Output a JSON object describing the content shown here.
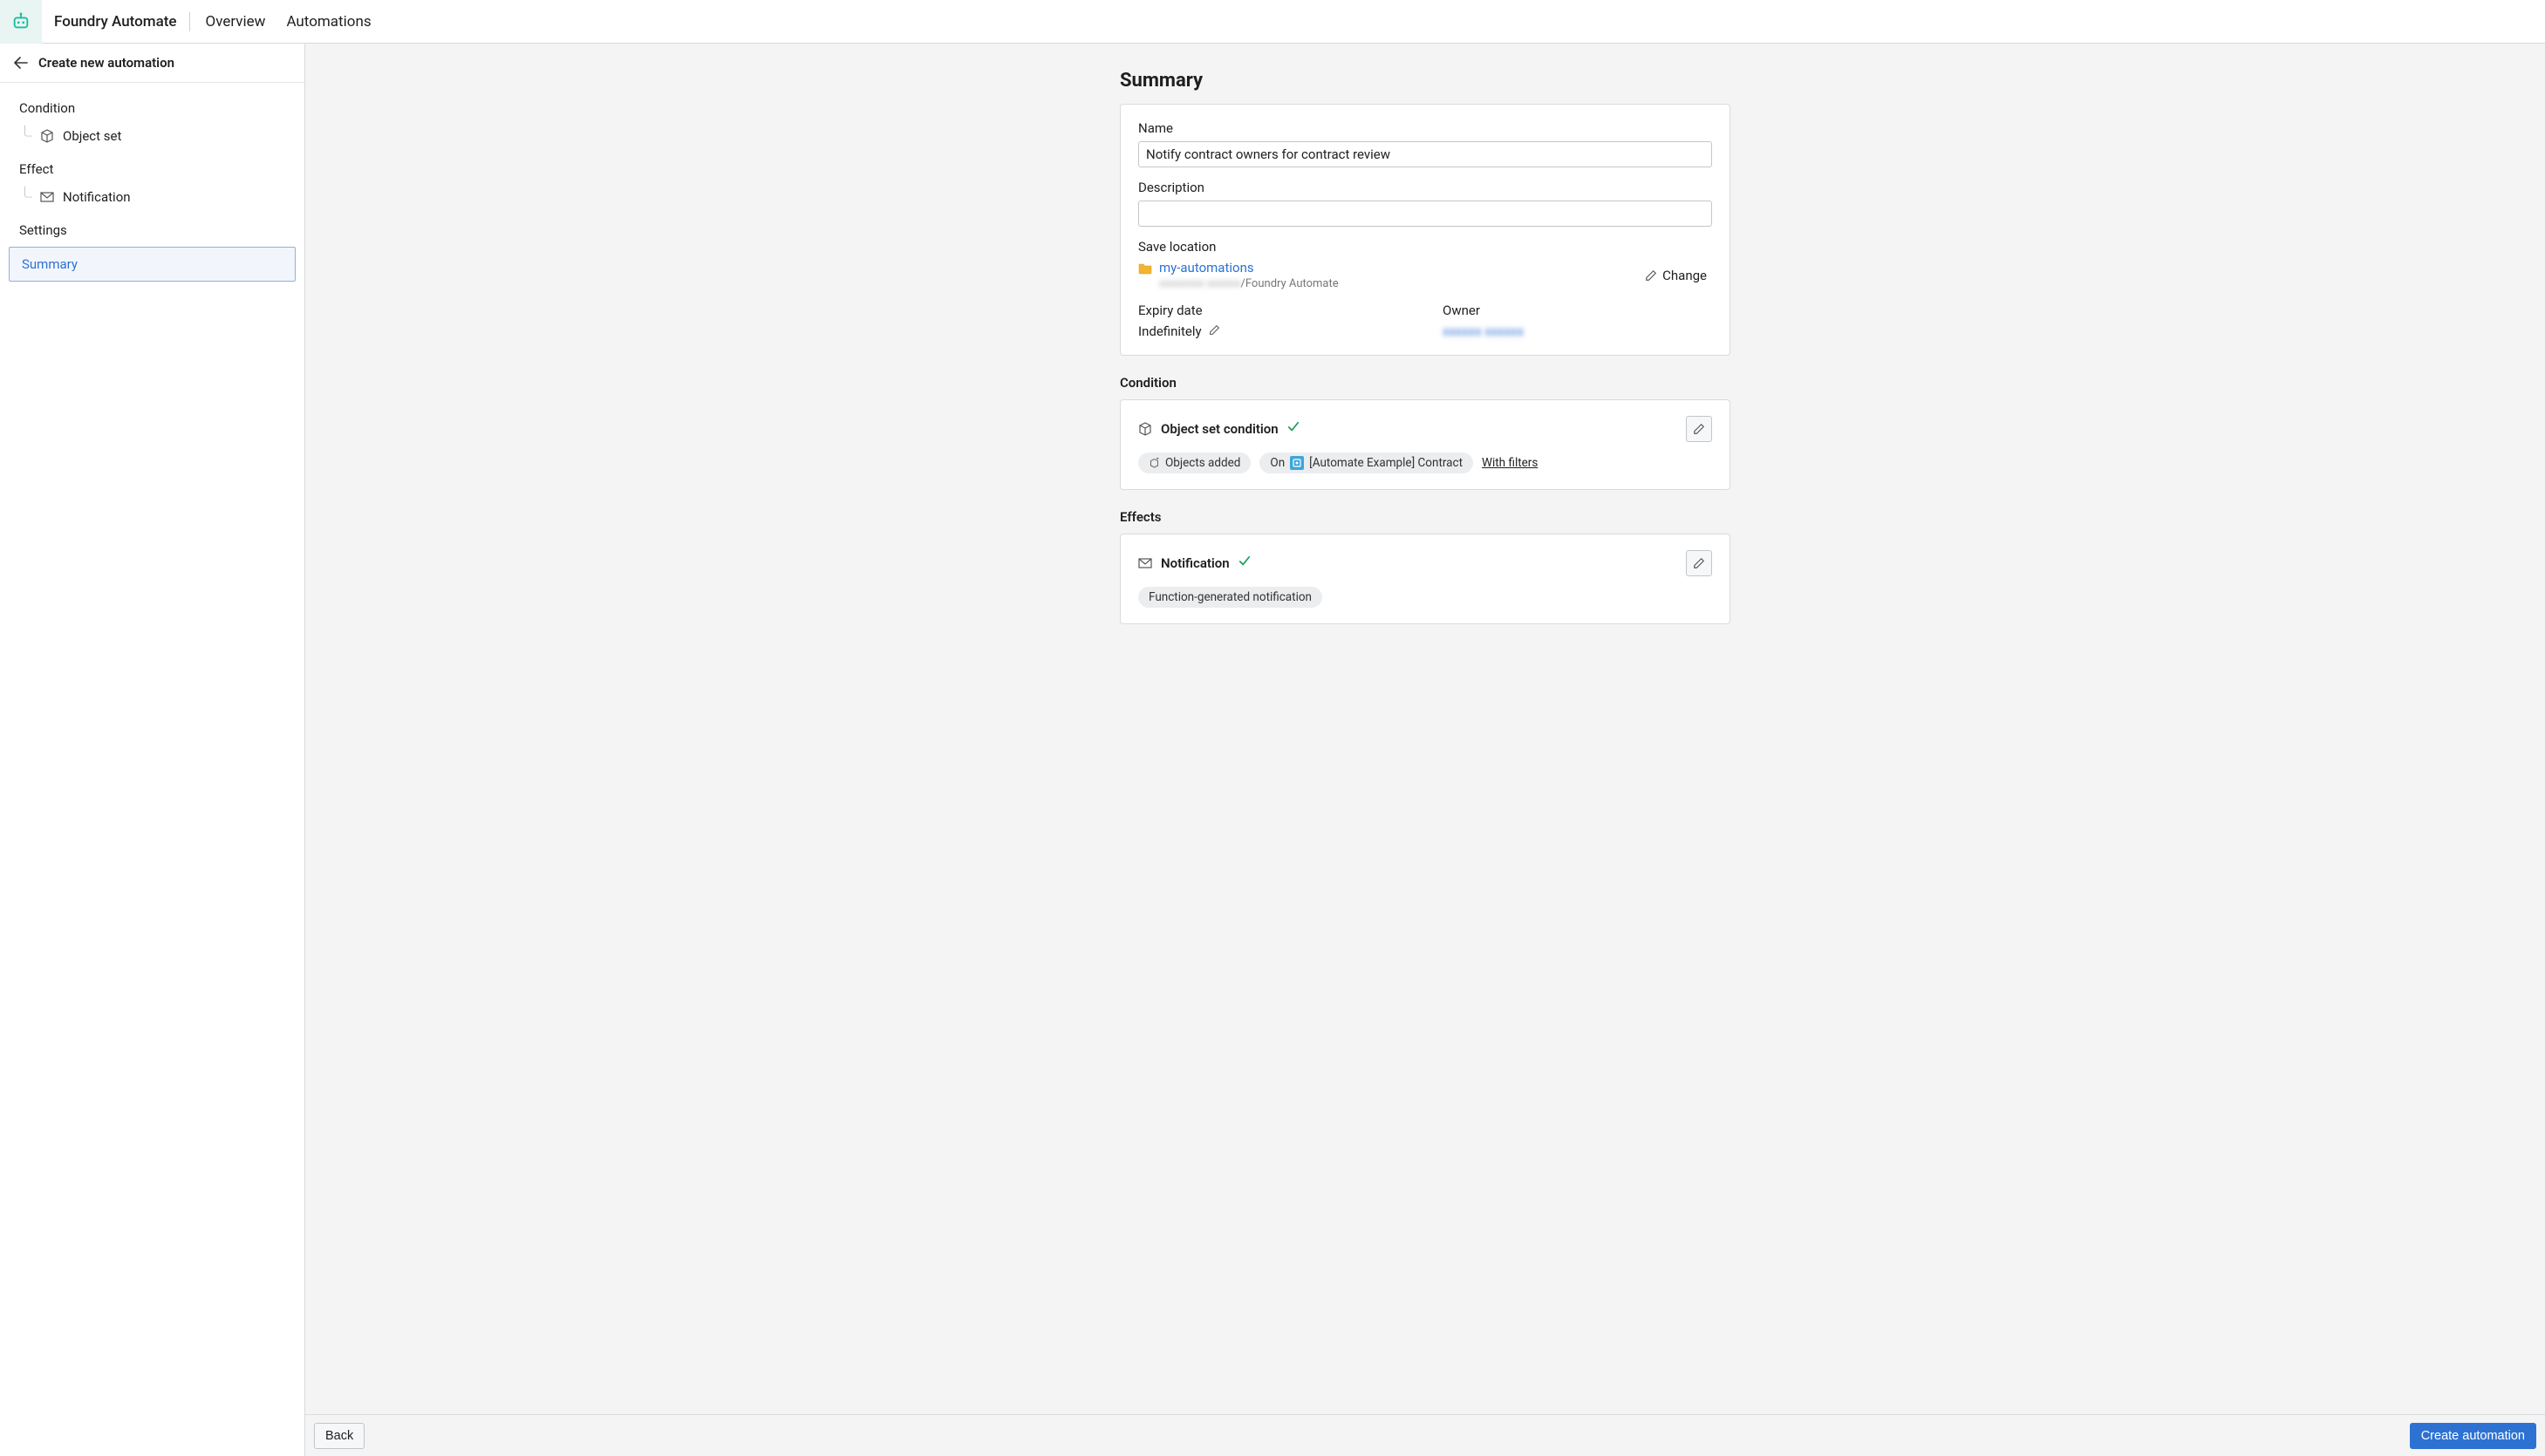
{
  "header": {
    "app_name": "Foundry Automate",
    "nav": [
      "Overview",
      "Automations"
    ]
  },
  "sidebar": {
    "back_title": "Create new automation",
    "sections": {
      "condition": {
        "label": "Condition",
        "item_label": "Object set"
      },
      "effect": {
        "label": "Effect",
        "item_label": "Notification"
      },
      "settings": {
        "label": "Settings"
      },
      "summary": {
        "label": "Summary"
      }
    }
  },
  "main": {
    "title": "Summary",
    "name": {
      "label": "Name",
      "value": "Notify contract owners for contract review"
    },
    "description": {
      "label": "Description",
      "value": ""
    },
    "save_location": {
      "label": "Save location",
      "folder_name": "my-automations",
      "path_hidden": "xxxxxxxx xxxxxx",
      "path_suffix": "/Foundry Automate",
      "change_label": "Change"
    },
    "expiry": {
      "label": "Expiry date",
      "value": "Indefinitely"
    },
    "owner": {
      "label": "Owner",
      "value_hidden": "xxxxxx xxxxxx"
    },
    "condition": {
      "heading": "Condition",
      "title": "Object set condition",
      "pills": {
        "objects_added": "Objects added",
        "on_prefix": "On",
        "object_type": "[Automate Example] Contract"
      },
      "filters_link": "With filters"
    },
    "effects": {
      "heading": "Effects",
      "title": "Notification",
      "pill": "Function-generated notification"
    }
  },
  "footer": {
    "back_label": "Back",
    "create_label": "Create automation"
  }
}
